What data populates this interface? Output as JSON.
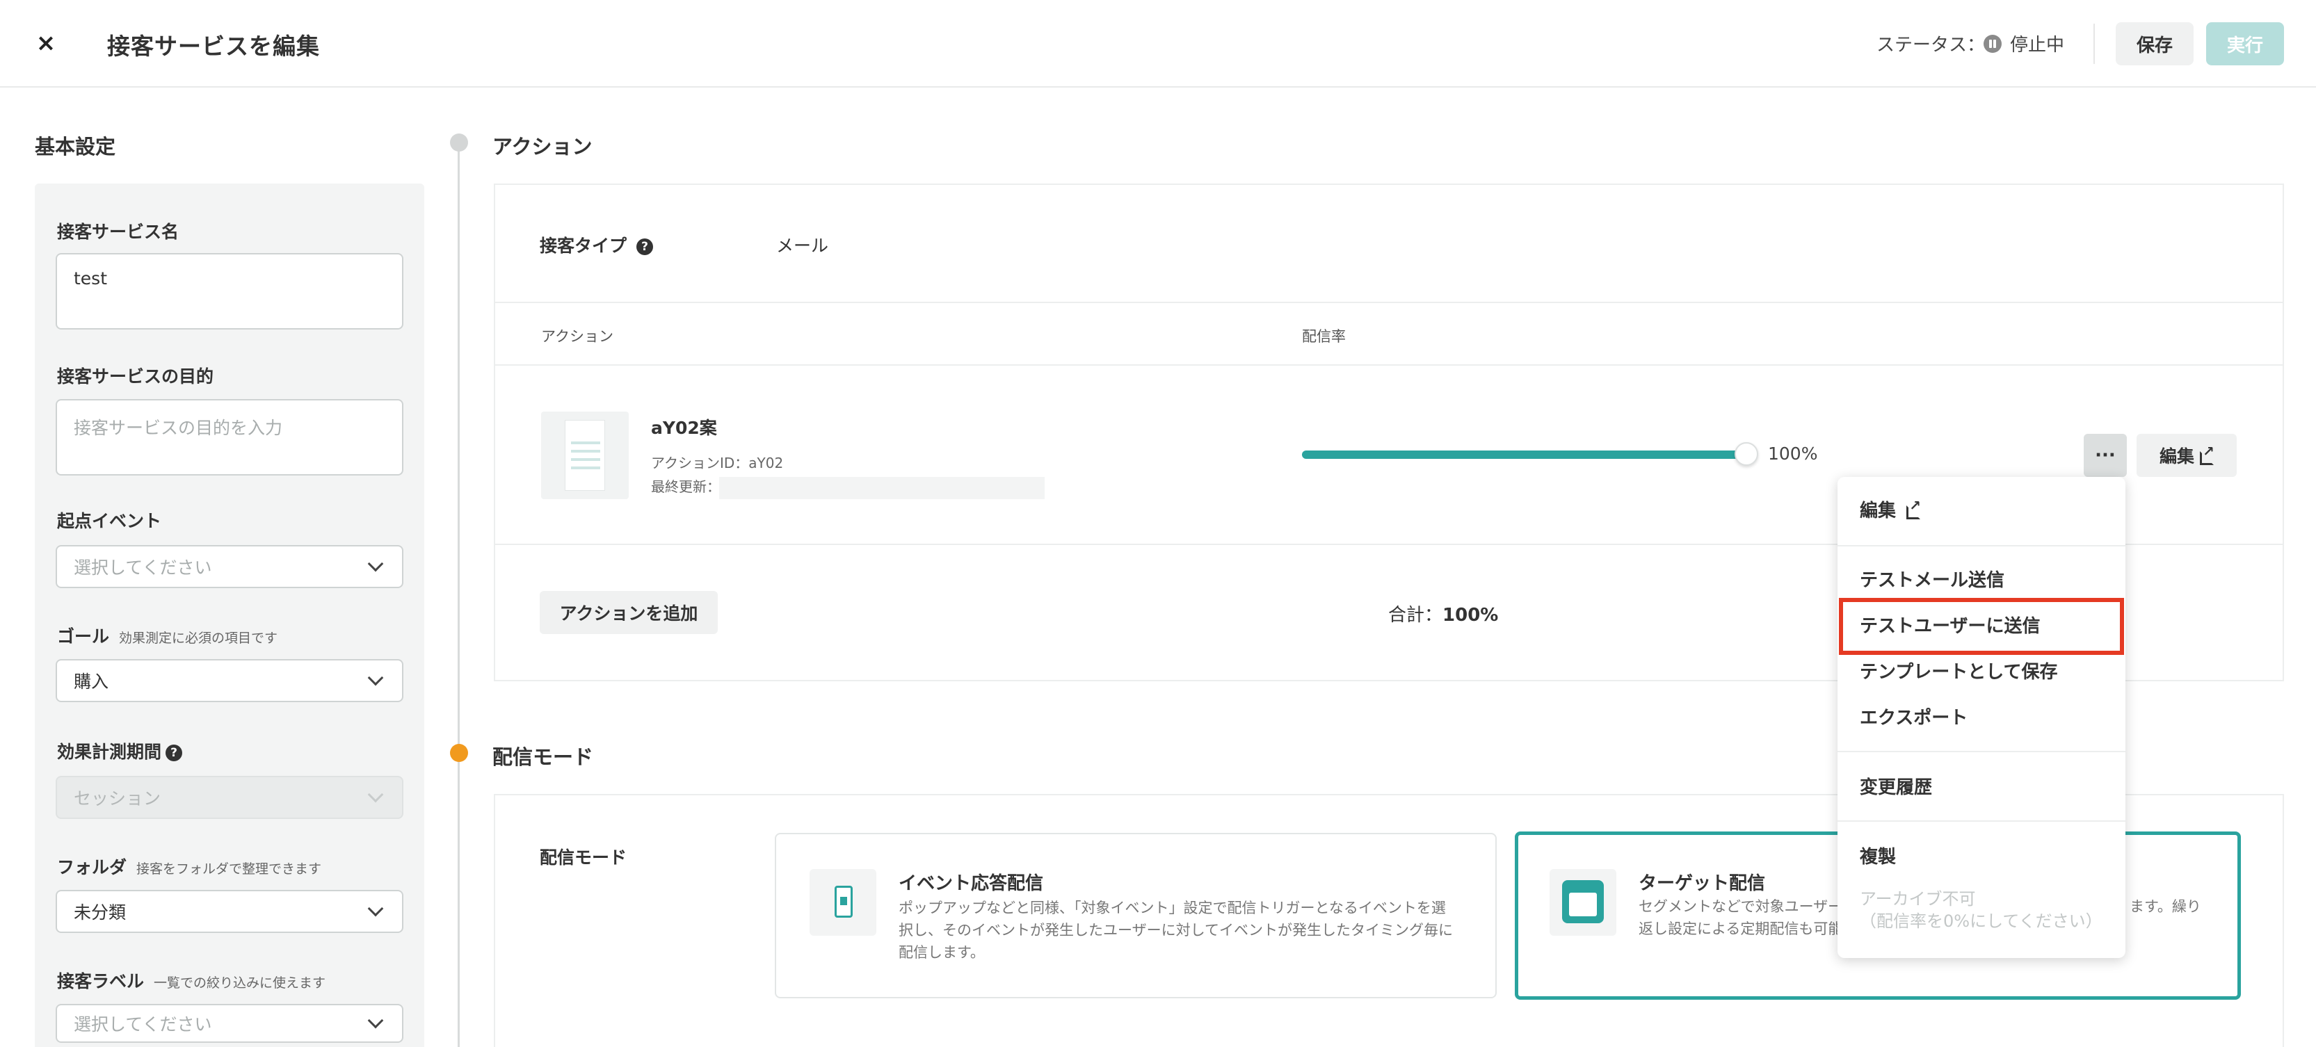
{
  "header": {
    "close_label": "×",
    "title": "接客サービスを編集",
    "status_label": "ステータス：",
    "status_value": "停止中",
    "save_label": "保存",
    "run_label": "実行"
  },
  "basic": {
    "title": "基本設定",
    "name_label": "接客サービス名",
    "name_value": "test",
    "purpose_label": "接客サービスの目的",
    "purpose_placeholder": "接客サービスの目的を入力",
    "start_event_label": "起点イベント",
    "start_event_placeholder": "選択してください",
    "goal_label": "ゴール",
    "goal_sub": "効果測定に必須の項目です",
    "goal_value": "購入",
    "period_label": "効果計測期間",
    "period_value": "セッション",
    "folder_label": "フォルダ",
    "folder_sub": "接客をフォルダで整理できます",
    "folder_value": "未分類",
    "tag_label": "接客ラベル",
    "tag_sub": "一覧での絞り込みに使えます",
    "tag_placeholder": "選択してください"
  },
  "action_section": {
    "title": "アクション",
    "type_label": "接客タイプ",
    "type_value": "メール",
    "col_action": "アクション",
    "col_rate": "配信率",
    "action_name": "aY02案",
    "action_id": "アクションID：aY02",
    "last_updated": "最終更新：",
    "rate_percent": 100,
    "rate_text": "100%",
    "edit_label": "編集",
    "more_label": "···",
    "add_action_label": "アクションを追加",
    "total_label": "合計：",
    "total_value": "100%"
  },
  "delivery": {
    "title": "配信モード",
    "row_label": "配信モード",
    "event_title": "イベント応答配信",
    "event_desc": "ポップアップなどと同様、「対象イベント」設定で配信トリガーとなるイベントを選択し、そのイベントが発生したユーザーに対してイベントが発生したタイミング毎に配信します。",
    "target_title": "ターゲット配信",
    "target_desc_1": "セグメントなどで対象ユーザー",
    "target_desc_1b": "ます。繰り",
    "target_desc_2": "返し設定による定期配信も可能で"
  },
  "menu": {
    "edit": "編集",
    "test_mail": "テストメール送信",
    "test_user": "テストユーザーに送信",
    "save_template": "テンプレートとして保存",
    "export": "エクスポート",
    "history": "変更履歴",
    "duplicate": "複製",
    "archive_disabled_1": "アーカイブ不可",
    "archive_disabled_2": "（配信率を0%にしてください）"
  },
  "colors": {
    "accent": "#2aa39e",
    "highlight": "#e53a23",
    "timeline_active": "#f19a1e"
  }
}
